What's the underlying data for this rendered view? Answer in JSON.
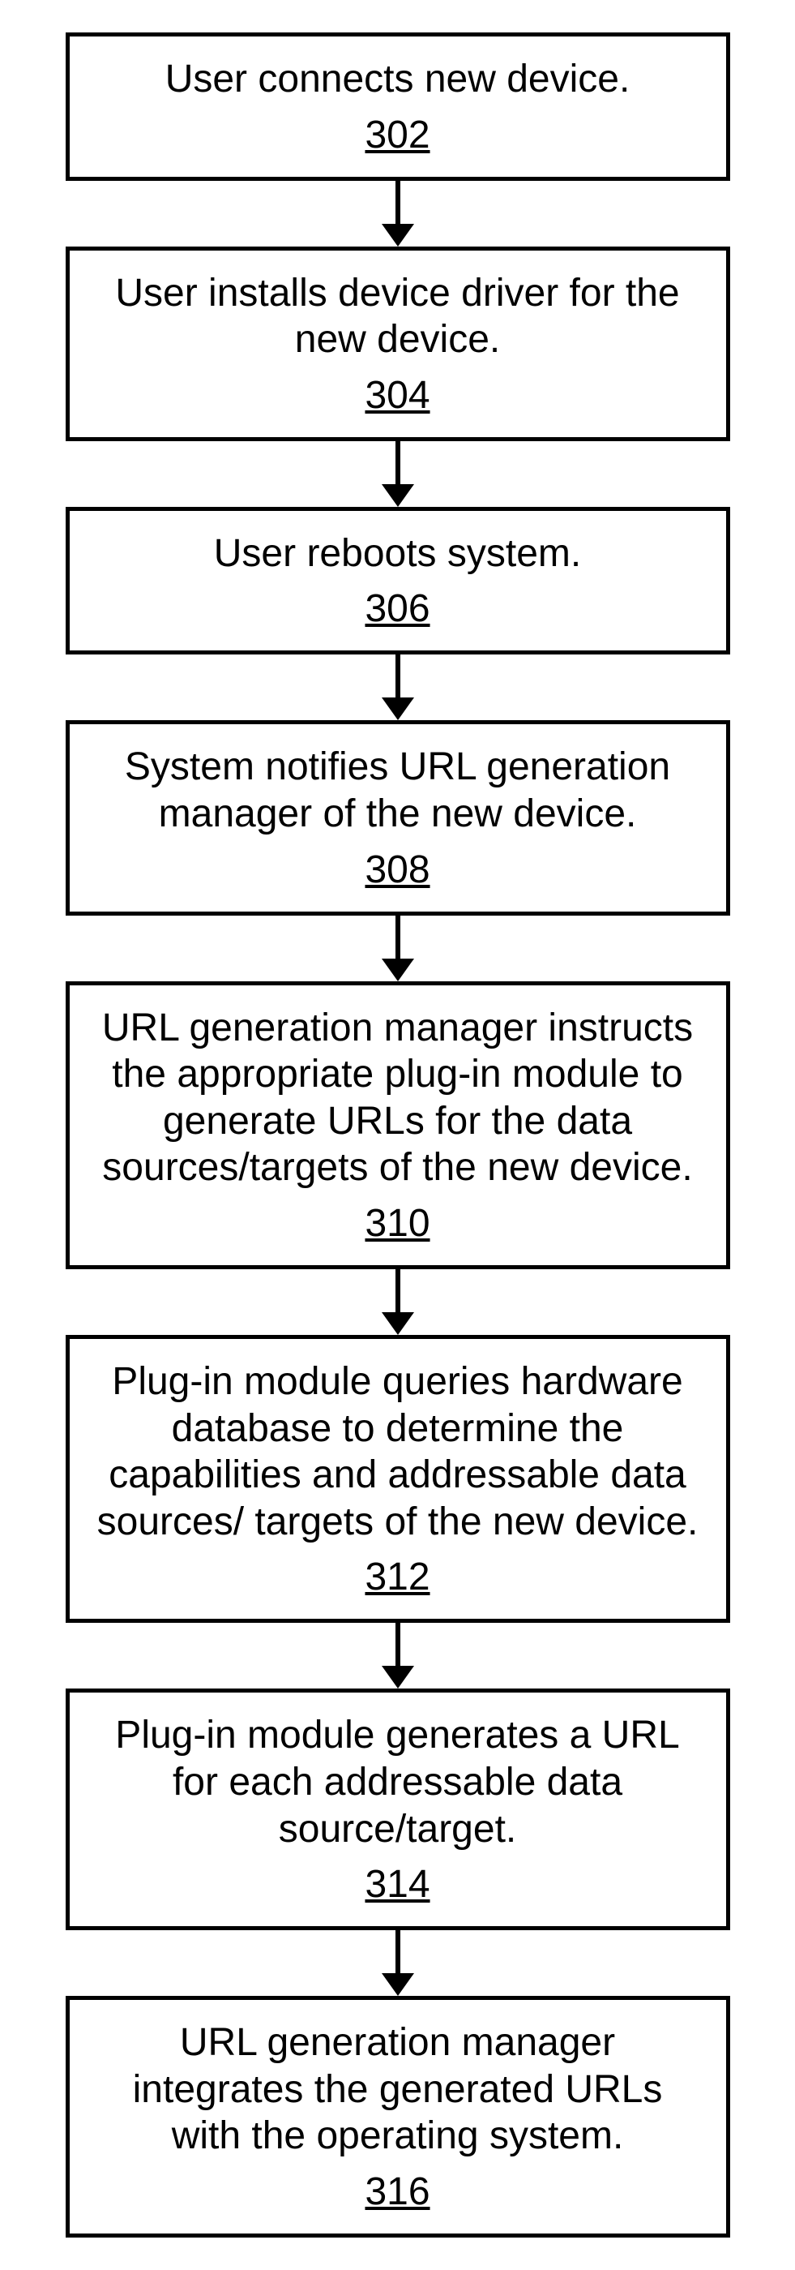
{
  "flowchart": {
    "steps": [
      {
        "text": "User connects new device.",
        "number": "302"
      },
      {
        "text": "User installs device driver for the new device.",
        "number": "304"
      },
      {
        "text": "User reboots system.",
        "number": "306"
      },
      {
        "text": "System notifies URL generation manager of the new device.",
        "number": "308"
      },
      {
        "text": "URL generation manager instructs the appropriate plug-in module to generate URLs for the data sources/targets of the new device.",
        "number": "310"
      },
      {
        "text": "Plug-in module queries hardware database to determine the capabilities and addressable data sources/ targets of the new device.",
        "number": "312"
      },
      {
        "text": "Plug-in module generates a URL for each addressable data source/target.",
        "number": "314"
      },
      {
        "text": "URL generation manager integrates the generated URLs with the operating system.",
        "number": "316"
      }
    ]
  }
}
